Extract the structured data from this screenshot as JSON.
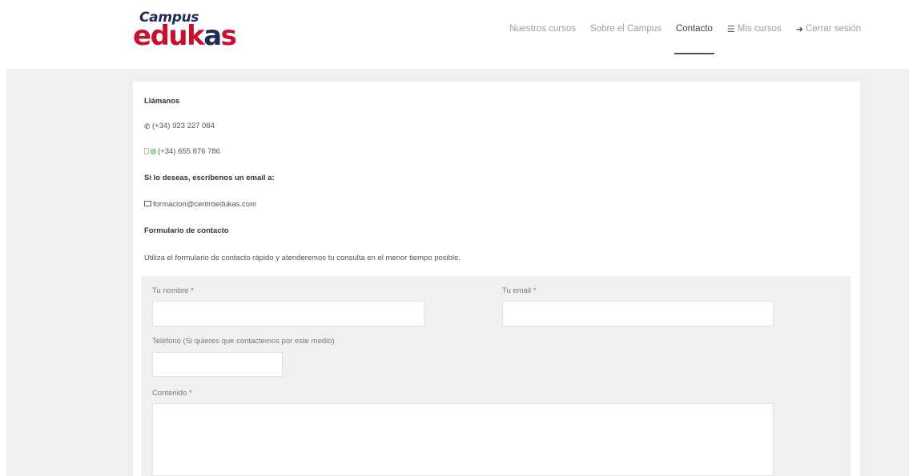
{
  "header": {
    "logo_top": "Campus",
    "logo_main_e": "e",
    "logo_main_duk": "duk",
    "logo_main_a": "a",
    "logo_main_s": "s",
    "nav": [
      {
        "label": "Nuestros cursos",
        "icon": null,
        "active": false
      },
      {
        "label": "Sobre el Campus",
        "icon": null,
        "active": false
      },
      {
        "label": "Contacto",
        "icon": null,
        "active": true
      },
      {
        "label": "Mis cursos",
        "icon": "graduation-cap-icon",
        "active": false
      },
      {
        "label": "Cerrar sesión",
        "icon": "sign-out-icon",
        "active": false
      }
    ]
  },
  "contact": {
    "call_heading": "Llámanos",
    "phone": "(+34) 923 227 084",
    "mobile": "(+34) 655 876 786",
    "email_heading": "Si lo deseas, escríbenos un email a:",
    "email": "formacion@centroedukas.com",
    "form_heading": "Formulario de contacto",
    "form_intro": "Utiliza el formulario de contacto rápido y atenderemos tu consulta en el menor tiempo posible."
  },
  "form": {
    "name_label": "Tu nombre *",
    "email_label": "Tu email *",
    "phone_label": "Teléfono (Si quieres que contactemos por este medio)",
    "content_label": "Contenido *",
    "name_value": "",
    "email_value": "",
    "phone_value": "",
    "content_value": ""
  },
  "colors": {
    "brand_red": "#c8102e",
    "brand_navy": "#1f2a56",
    "page_grey": "#f0f0f0"
  }
}
